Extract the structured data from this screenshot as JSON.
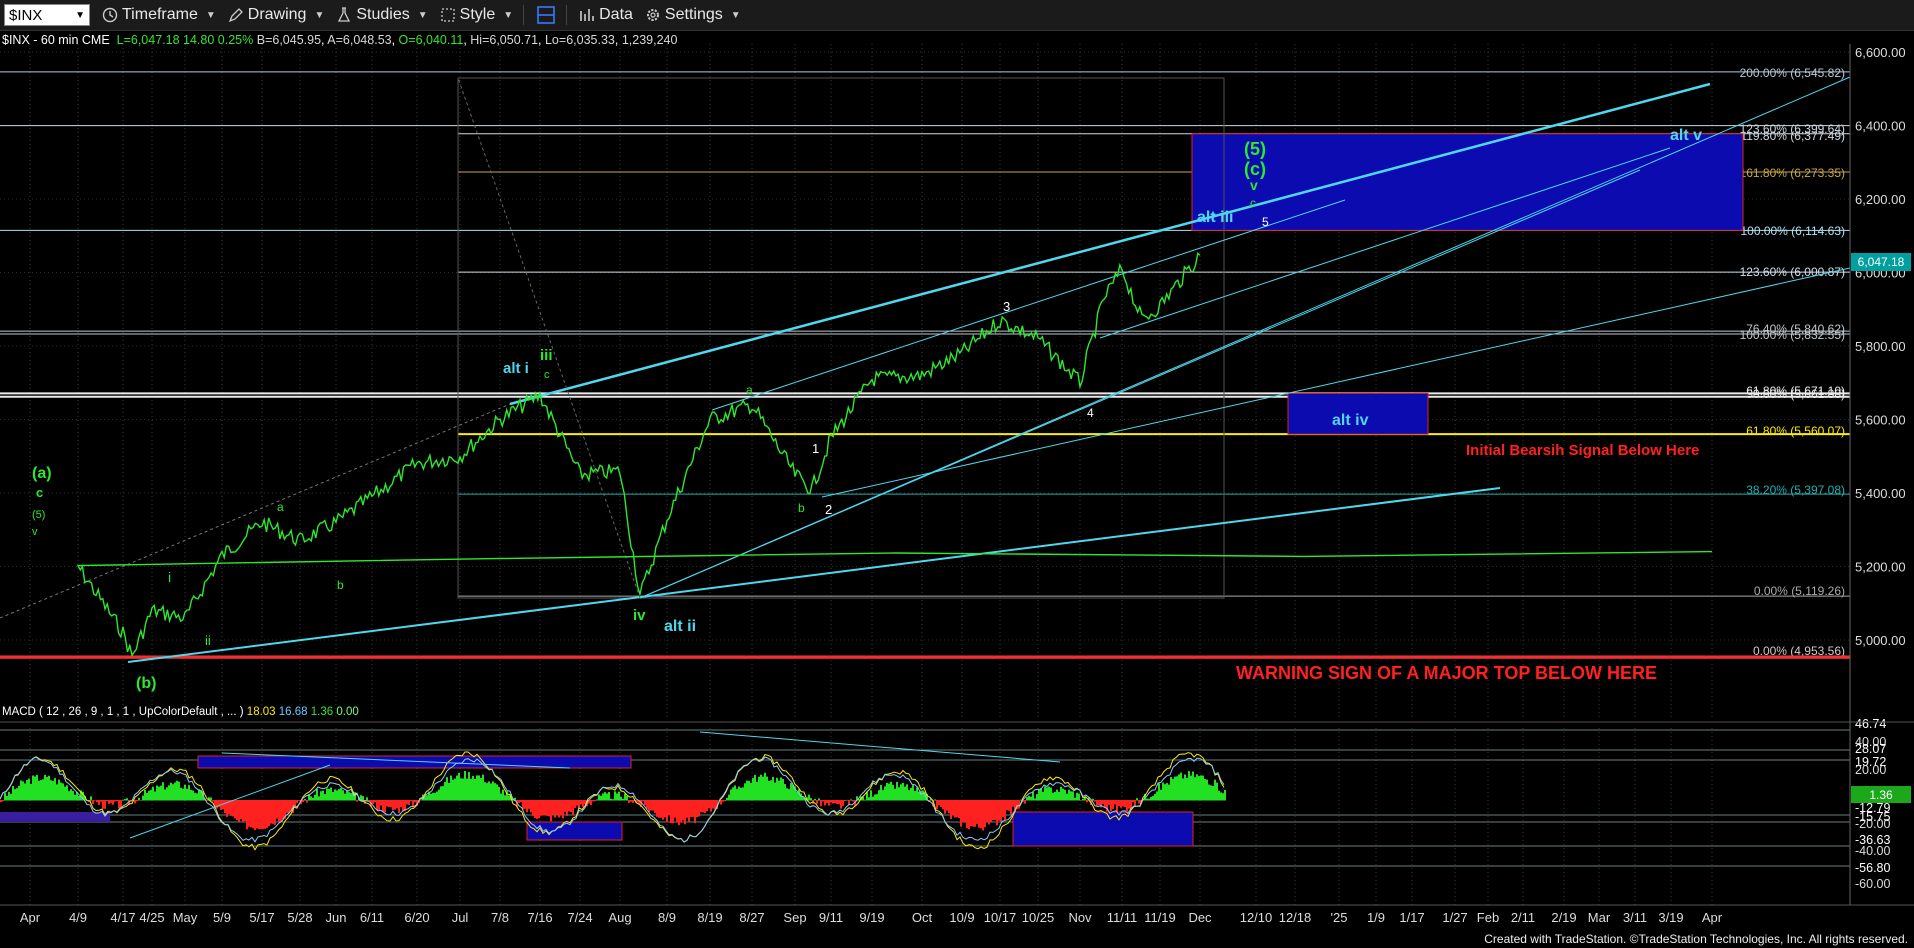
{
  "toolbar": {
    "symbol": "$INX",
    "items": [
      {
        "label": "Timeframe",
        "icon": "clock-icon"
      },
      {
        "label": "Drawing",
        "icon": "pencil-icon"
      },
      {
        "label": "Studies",
        "icon": "flask-icon"
      },
      {
        "label": "Style",
        "icon": "style-icon"
      },
      {
        "label": "",
        "icon": "layout-icon"
      },
      {
        "label": "Data",
        "icon": "bar-chart-icon"
      },
      {
        "label": "Settings",
        "icon": "gear-icon"
      }
    ]
  },
  "quote": {
    "symbol": "$INX - 60 min CME",
    "last": "L=6,047.18",
    "change": "14.80",
    "pct": "0.25%",
    "bid": "B=6,045.95",
    "ask": "A=6,048.53",
    "open": "O=6,040.11",
    "high": "Hi=6,050.71",
    "low": "Lo=6,035.33",
    "volume": "1,239,240"
  },
  "macd_label": {
    "text": "MACD ( 12 , 26 , 9 , 1 , 1 , UpColorDefault , ... )",
    "v1": "18.03",
    "v2": "16.68",
    "v3": "1.36",
    "v4": "0.00"
  },
  "last_price": "6,047.18",
  "macd_last": "1.36",
  "footer": "Created with TradeStation. ©TradeStation Technologies, Inc. All rights reserved.",
  "chart_data": {
    "type": "line",
    "title": "$INX - 60 min CME",
    "price_axis": [
      "6,600.00",
      "6,400.00",
      "6,200.00",
      "6,000.00",
      "5,800.00",
      "5,600.00",
      "5,400.00",
      "5,200.00",
      "5,000.00"
    ],
    "macd_axis": [
      "46.74",
      "40.00",
      "28.07",
      "19.72",
      "20.00",
      "-12.79",
      "-15.75",
      "-20.00",
      "-36.63",
      "-40.00",
      "-56.80",
      "-60.00"
    ],
    "date_axis": [
      "Apr",
      "4/9",
      "4/17",
      "4/25",
      "May",
      "5/9",
      "5/17",
      "5/28",
      "Jun",
      "6/11",
      "6/20",
      "Jul",
      "7/8",
      "7/16",
      "7/24",
      "Aug",
      "8/9",
      "8/19",
      "8/27",
      "Sep",
      "9/11",
      "9/19",
      "Oct",
      "10/9",
      "10/17",
      "10/25",
      "Nov",
      "11/11",
      "11/19",
      "Dec",
      "12/10",
      "12/18",
      "'25",
      "1/9",
      "1/17",
      "1/27",
      "Feb",
      "2/11",
      "2/19",
      "Mar",
      "3/11",
      "3/19",
      "Apr"
    ],
    "fib_levels": [
      {
        "label": "200.00% (6,545.82)",
        "value": 6545.82
      },
      {
        "label": "123.60% (6,399.64)",
        "value": 6399.64
      },
      {
        "label": "119.80% (6,377.49)",
        "value": 6377.49
      },
      {
        "label": "161.80% (6,273.35)",
        "value": 6273.35
      },
      {
        "label": "100.00% (6,114.63)",
        "value": 6114.63
      },
      {
        "label": "123.60% (6,000.87)",
        "value": 6000.87
      },
      {
        "label": "76.40% (5,840.62)",
        "value": 5840.62
      },
      {
        "label": "100.00% (5,832.55)",
        "value": 5832.55
      },
      {
        "label": "61.80% (5,671.10)",
        "value": 5671.1
      },
      {
        "label": "50.00% (5,661.88)",
        "value": 5661.88
      },
      {
        "label": "61.80% (5,560.07)",
        "value": 5560.07
      },
      {
        "label": "38.20% (5,397.08)",
        "value": 5397.08
      },
      {
        "label": "0.00% (5,119.26)",
        "value": 5119.26
      },
      {
        "label": "0.00% (4,953.56)",
        "value": 4953.56
      }
    ],
    "price_series": [
      [
        "Apr",
        5240
      ],
      [
        "4/9",
        5200
      ],
      [
        "4/17",
        5020
      ],
      [
        "4/19",
        4955
      ],
      [
        "4/25",
        5080
      ],
      [
        "May",
        5060
      ],
      [
        "5/9",
        5230
      ],
      [
        "5/17",
        5320
      ],
      [
        "5/28",
        5270
      ],
      [
        "Jun",
        5320
      ],
      [
        "6/11",
        5390
      ],
      [
        "6/20",
        5480
      ],
      [
        "Jul",
        5500
      ],
      [
        "7/8",
        5600
      ],
      [
        "7/16",
        5667
      ],
      [
        "7/24",
        5450
      ],
      [
        "Aug",
        5460
      ],
      [
        "8/5",
        5120
      ],
      [
        "8/9",
        5330
      ],
      [
        "8/19",
        5600
      ],
      [
        "8/27",
        5640
      ],
      [
        "Sep",
        5450
      ],
      [
        "9/6",
        5410
      ],
      [
        "9/11",
        5550
      ],
      [
        "9/19",
        5710
      ],
      [
        "Oct",
        5720
      ],
      [
        "10/9",
        5780
      ],
      [
        "10/17",
        5870
      ],
      [
        "10/25",
        5820
      ],
      [
        "Nov",
        5700
      ],
      [
        "11/6",
        5930
      ],
      [
        "11/11",
        6010
      ],
      [
        "11/15",
        5870
      ],
      [
        "11/19",
        5910
      ],
      [
        "Dec",
        6047
      ]
    ],
    "annotations": [
      "(a)",
      "c",
      "(5)",
      "v",
      "i",
      "ii",
      "a",
      "b",
      "(b)",
      "alt i",
      "iii",
      "c",
      "iv",
      "alt ii",
      "a",
      "1",
      "b",
      "2",
      "3",
      "4",
      "alt iii",
      "5",
      "c",
      "v",
      "(c)",
      "(5)",
      "alt v",
      "alt iv",
      "Initial Bearsih Signal Below Here",
      "WARNING SIGN OF A MAJOR TOP BELOW HERE"
    ]
  }
}
